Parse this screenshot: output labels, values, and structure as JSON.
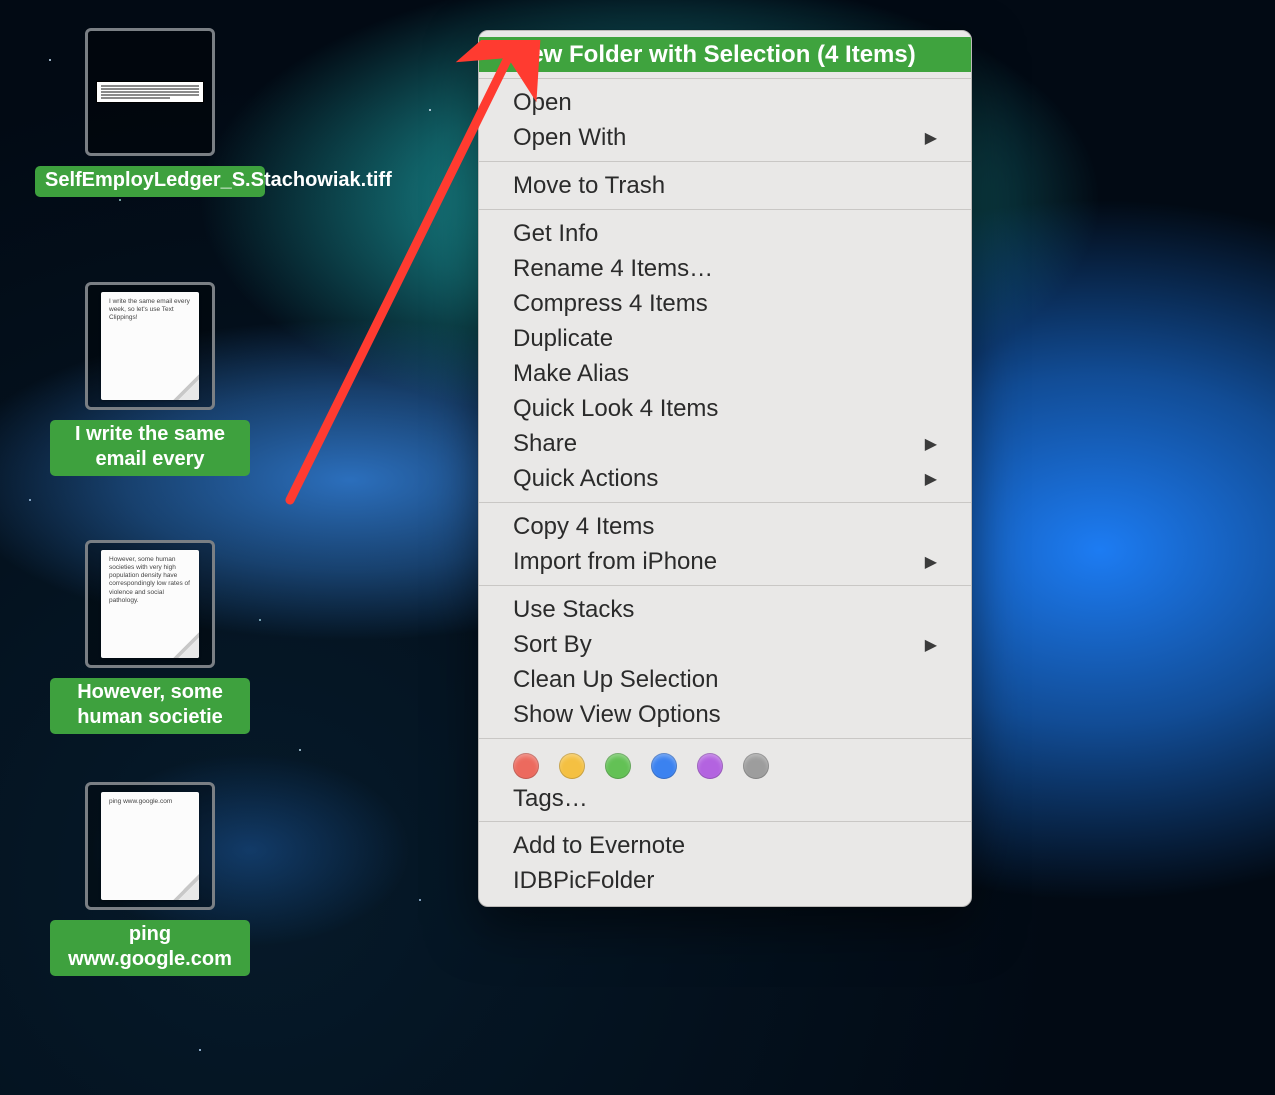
{
  "desktop_icons": [
    {
      "label": "SelfEmployLedger_S.Stachowiak.tiff",
      "preview_text": ""
    },
    {
      "label": "I write the same email every",
      "preview_text": "I write the same email every week, so let's use Text Clippings!"
    },
    {
      "label": "However, some human societie",
      "preview_text": "However, some human societies with very high population density have correspondingly low rates of violence and social pathology."
    },
    {
      "label": "ping www.google.com",
      "preview_text": "ping www.google.com"
    }
  ],
  "menu": {
    "highlighted": "New Folder with Selection (4 Items)",
    "groups": [
      [
        {
          "label": "Open",
          "submenu": false
        },
        {
          "label": "Open With",
          "submenu": true
        }
      ],
      [
        {
          "label": "Move to Trash",
          "submenu": false
        }
      ],
      [
        {
          "label": "Get Info",
          "submenu": false
        },
        {
          "label": "Rename 4 Items…",
          "submenu": false
        },
        {
          "label": "Compress 4 Items",
          "submenu": false
        },
        {
          "label": "Duplicate",
          "submenu": false
        },
        {
          "label": "Make Alias",
          "submenu": false
        },
        {
          "label": "Quick Look 4 Items",
          "submenu": false
        },
        {
          "label": "Share",
          "submenu": true
        },
        {
          "label": "Quick Actions",
          "submenu": true
        }
      ],
      [
        {
          "label": "Copy 4 Items",
          "submenu": false
        },
        {
          "label": "Import from iPhone",
          "submenu": true
        }
      ],
      [
        {
          "label": "Use Stacks",
          "submenu": false
        },
        {
          "label": "Sort By",
          "submenu": true
        },
        {
          "label": "Clean Up Selection",
          "submenu": false
        },
        {
          "label": "Show View Options",
          "submenu": false
        }
      ]
    ],
    "tags_label": "Tags…",
    "tag_colors": [
      "#ec6a5e",
      "#f4c042",
      "#63c155",
      "#3b82f0",
      "#b363e0",
      "#9d9d9d"
    ],
    "footer": [
      {
        "label": "Add to Evernote",
        "submenu": false
      },
      {
        "label": "IDBPicFolder",
        "submenu": false
      }
    ]
  }
}
